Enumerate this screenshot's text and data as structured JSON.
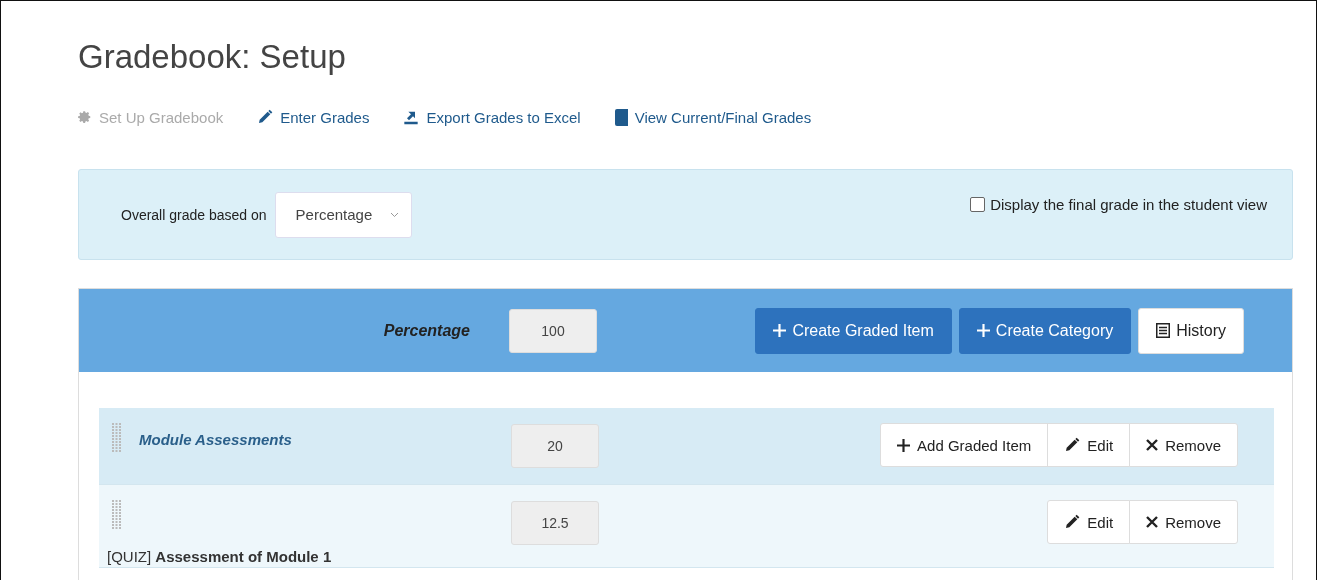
{
  "page": {
    "title": "Gradebook: Setup"
  },
  "nav": [
    {
      "kind": "gear",
      "label": "Set Up Gradebook",
      "disabled": true
    },
    {
      "kind": "pencil",
      "label": "Enter Grades",
      "disabled": false
    },
    {
      "kind": "export",
      "label": "Export Grades to Excel",
      "disabled": false
    },
    {
      "kind": "book",
      "label": "View Current/Final Grades",
      "disabled": false
    }
  ],
  "settings": {
    "label": "Overall grade based on",
    "select_value": "Percentage",
    "checkbox_label": "Display the final grade in the student view",
    "checked": false
  },
  "header": {
    "label": "Percentage",
    "value": "100",
    "buttons": [
      {
        "kind": "plus",
        "label": "Create Graded Item"
      },
      {
        "kind": "plus",
        "label": "Create Category"
      },
      {
        "kind": "history",
        "label": "History"
      }
    ]
  },
  "rows": [
    {
      "kind": "category",
      "name": "Module Assessments",
      "value": "20",
      "actions": [
        {
          "kind": "plus",
          "label": "Add Graded Item"
        },
        {
          "kind": "pencil",
          "label": "Edit"
        },
        {
          "kind": "cross",
          "label": "Remove"
        }
      ]
    },
    {
      "kind": "item",
      "name": "[QUIZ] **Assessment of Module 1**",
      "value": "12.5",
      "actions": [
        {
          "kind": "pencil",
          "label": "Edit"
        },
        {
          "kind": "cross",
          "label": "Remove"
        }
      ]
    }
  ]
}
